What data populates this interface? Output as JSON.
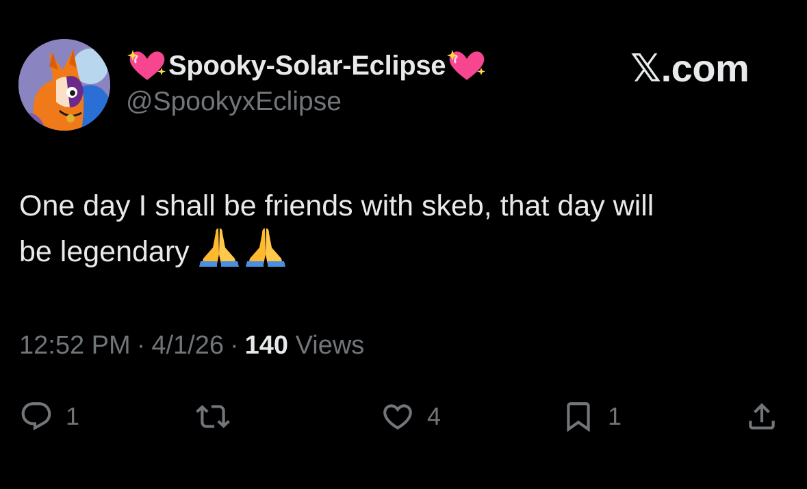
{
  "author": {
    "display_name": "Spooky-Solar-Eclipse",
    "handle": "@SpookyxEclipse",
    "name_emoji": "sparkling-heart-icon"
  },
  "brand": {
    "label": "𝕏.com"
  },
  "tweet": {
    "line1": "One day I shall be friends with skeb, that day will",
    "line2": "be legendary",
    "emoji": "folded-hands-icon"
  },
  "meta": {
    "time": "12:52 PM",
    "sep": "·",
    "date": "4/1/26",
    "views_count": "140",
    "views_label": "Views"
  },
  "actions": {
    "reply_count": "1",
    "like_count": "4",
    "bookmark_count": "1"
  },
  "colors": {
    "background": "#000000",
    "primary_text": "#e7e9ea",
    "secondary_text": "#71767b",
    "heart_pink": "#f7468f"
  }
}
